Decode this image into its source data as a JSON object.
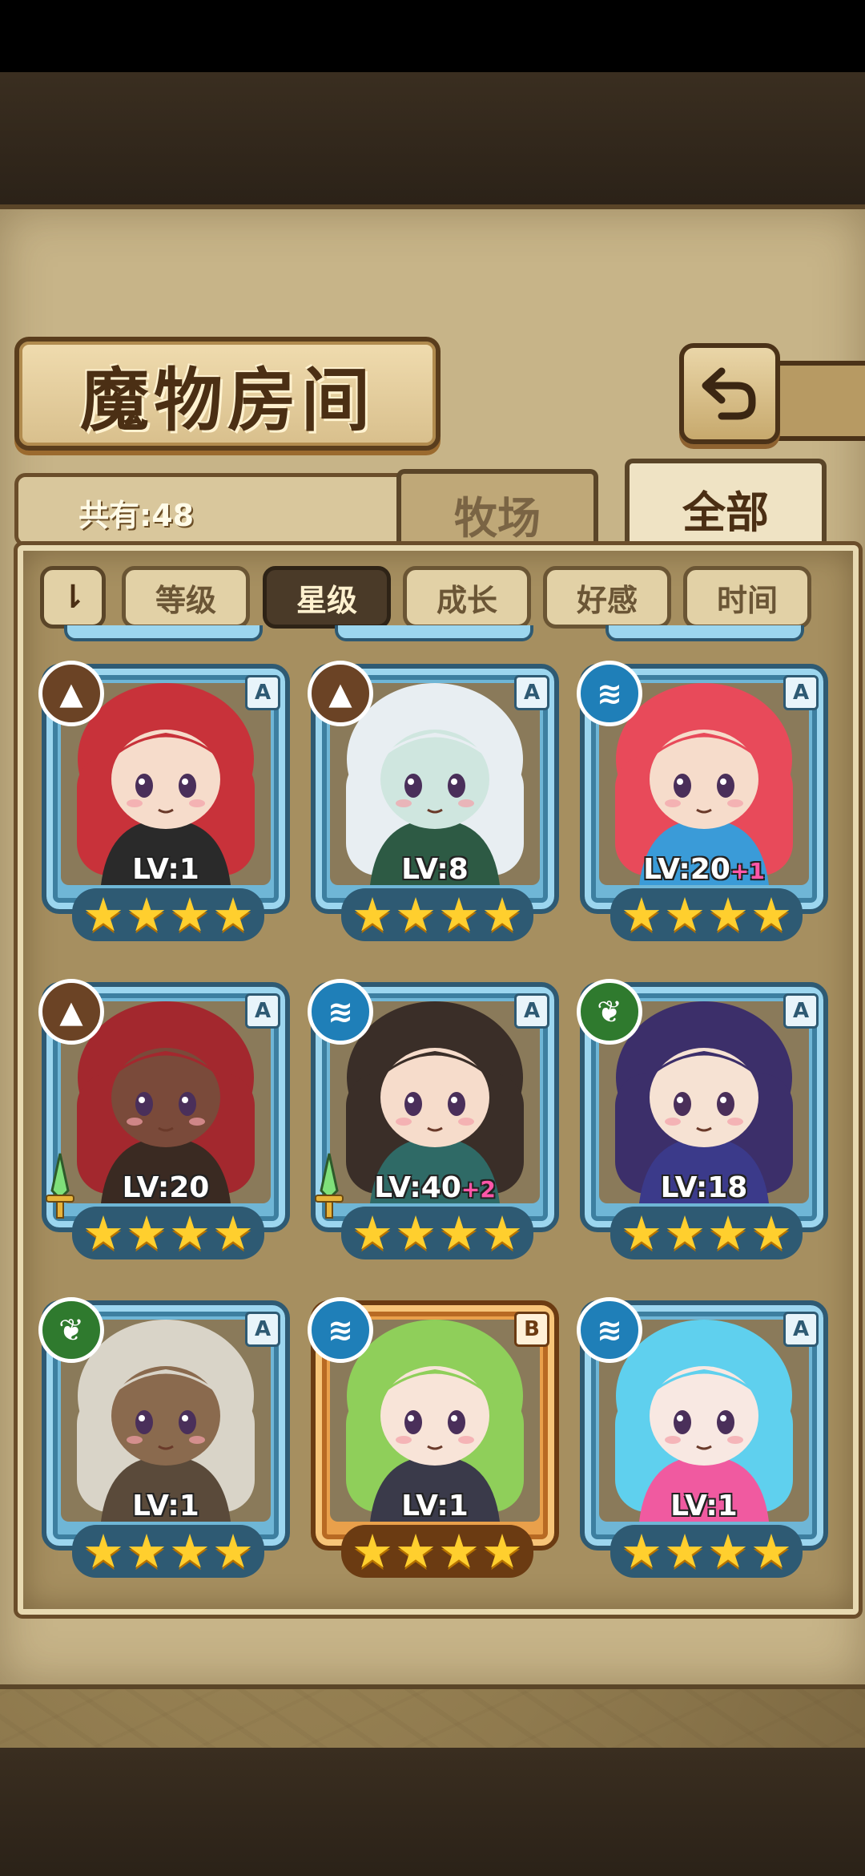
{
  "screen": {
    "title": "魔物房间",
    "count_label": "共有:48",
    "tabs": [
      {
        "label": "牧场",
        "active": false
      },
      {
        "label": "全部",
        "active": true
      }
    ],
    "sort_toggle_label": "⇂",
    "sort_buttons": [
      {
        "label": "等级",
        "active": false
      },
      {
        "label": "星级",
        "active": true
      },
      {
        "label": "成长",
        "active": false
      },
      {
        "label": "好感",
        "active": false
      },
      {
        "label": "时间",
        "active": false
      }
    ]
  },
  "monsters": [
    {
      "element": "earth",
      "rank": "A",
      "level": "LV:1",
      "plus": "",
      "stars": 4,
      "weapon": false,
      "hair": "#c8323a",
      "skin": "#f6dccb",
      "outfit": "#2a2a2a"
    },
    {
      "element": "earth",
      "rank": "A",
      "level": "LV:8",
      "plus": "",
      "stars": 4,
      "weapon": false,
      "hair": "#e8eef2",
      "skin": "#cfe6df",
      "outfit": "#2d5a44"
    },
    {
      "element": "water",
      "rank": "A",
      "level": "LV:20",
      "plus": "+1",
      "stars": 4,
      "weapon": false,
      "hair": "#e84a5a",
      "skin": "#f6dccb",
      "outfit": "#3a9bd8"
    },
    {
      "element": "earth",
      "rank": "A",
      "level": "LV:20",
      "plus": "",
      "stars": 4,
      "weapon": true,
      "hair": "#a3282e",
      "skin": "#7a4a3a",
      "outfit": "#3a2a22"
    },
    {
      "element": "water",
      "rank": "A",
      "level": "LV:40",
      "plus": "+2",
      "stars": 4,
      "weapon": true,
      "hair": "#3a2e28",
      "skin": "#f6dccb",
      "outfit": "#2f6a66"
    },
    {
      "element": "leaf",
      "rank": "A",
      "level": "LV:18",
      "plus": "",
      "stars": 4,
      "weapon": false,
      "hair": "#3c2f6a",
      "skin": "#f6e2d3",
      "outfit": "#3b3a8a"
    },
    {
      "element": "leaf",
      "rank": "A",
      "level": "LV:1",
      "plus": "",
      "stars": 4,
      "weapon": false,
      "hair": "#d9d4c8",
      "skin": "#8a6a4e",
      "outfit": "#5a4a3a"
    },
    {
      "element": "water",
      "rank": "B",
      "level": "LV:1",
      "plus": "",
      "stars": 4,
      "weapon": false,
      "hair": "#8fcf5a",
      "skin": "#f8e4d8",
      "outfit": "#3a3a4a"
    },
    {
      "element": "water",
      "rank": "A",
      "level": "LV:1",
      "plus": "",
      "stars": 4,
      "weapon": false,
      "hair": "#5fd0ee",
      "skin": "#f8e8e2",
      "outfit": "#f05aa0"
    }
  ],
  "colors": {
    "frame_a": "#6fb6d6",
    "frame_b": "#e9a04b",
    "star": "#ffcf2e",
    "plus_text": "#ff56a8"
  },
  "element_icons": {
    "earth": "mountain-icon",
    "water": "water-waves-icon",
    "leaf": "leaf-icon"
  }
}
